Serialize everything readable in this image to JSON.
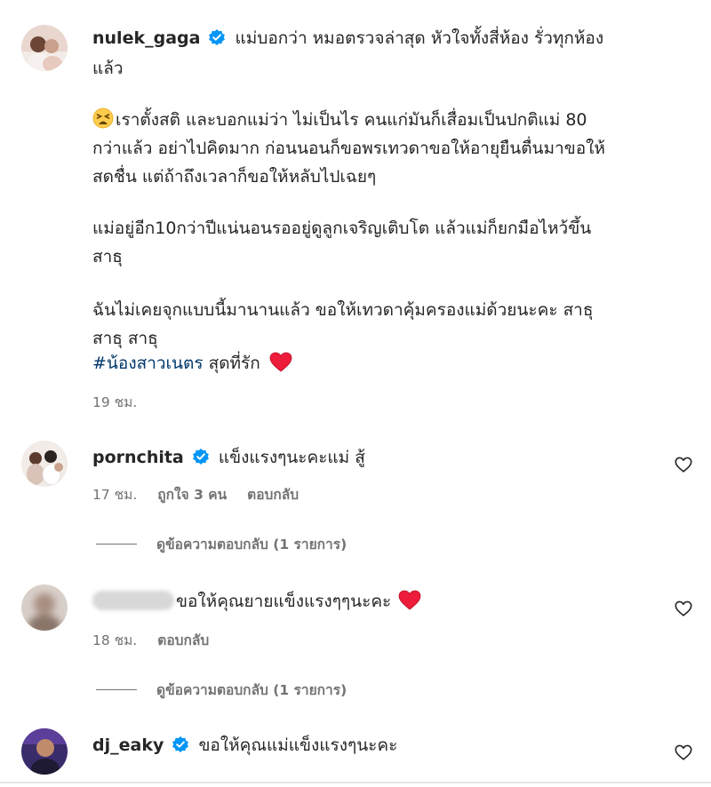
{
  "main_comment": {
    "username": "nulek_gaga",
    "lines": [
      "แม่บอกว่า หมอตรวจล่าสุด หัวใจทั้งสี่ห้อง รั่วทุกห้อง",
      "แล้ว",
      "เราตั้งสติ และบอกแม่ว่า ไม่เป็นไร คนแก่มันก็เสื่อมเป็นปกติแม่ 80",
      "กว่าแล้ว อย่าไปคิดมาก ก่อนนอนก็ขอพรเทวดาขอให้อายุยืนตื่นมาขอให้",
      "สดชื่น แต่ถ้าถึงเวลาก็ขอให้หลับไปเฉยๆ",
      "แม่อยู่อีก10กว่าปีแน่นอนรออยู่ดูลูกเจริญเติบโต แล้วแม่ก็ยกมือไหว้ขึ้น",
      "สาธุ",
      "ฉันไม่เคยจุกแบบนี้มานานแล้ว ขอให้เทวดาคุ้มครองแม่ด้วยนะคะ สาธุ",
      "สาธุ สาธุ"
    ],
    "hashtag": "#น้องสาวเนตร",
    "hashtag_suffix": " สุดที่รัก",
    "time": "19 ชม."
  },
  "replies": [
    {
      "username": "pornchita",
      "text": "แข็งแรงๆนะคะแม่ สู้",
      "time": "17 ชม.",
      "likes": "ถูกใจ 3 คน",
      "reply_label": "ตอบกลับ",
      "view_replies": "ดูข้อความตอบกลับ (1 รายการ)"
    },
    {
      "username": "",
      "text": "ขอให้คุณยายแข็งแรงๆๆนะคะ",
      "time": "18 ชม.",
      "reply_label": "ตอบกลับ",
      "view_replies": "ดูข้อความตอบกลับ (1 รายการ)"
    },
    {
      "username": "dj_eaky",
      "text": "ขอให้คุณแม่แข็งแรงๆนะคะ"
    }
  ],
  "colors": {
    "text": "#262626",
    "meta": "#737373",
    "verified": "#0095f6",
    "hashtag": "#00376b",
    "heart_red": "#ed1c3a"
  }
}
